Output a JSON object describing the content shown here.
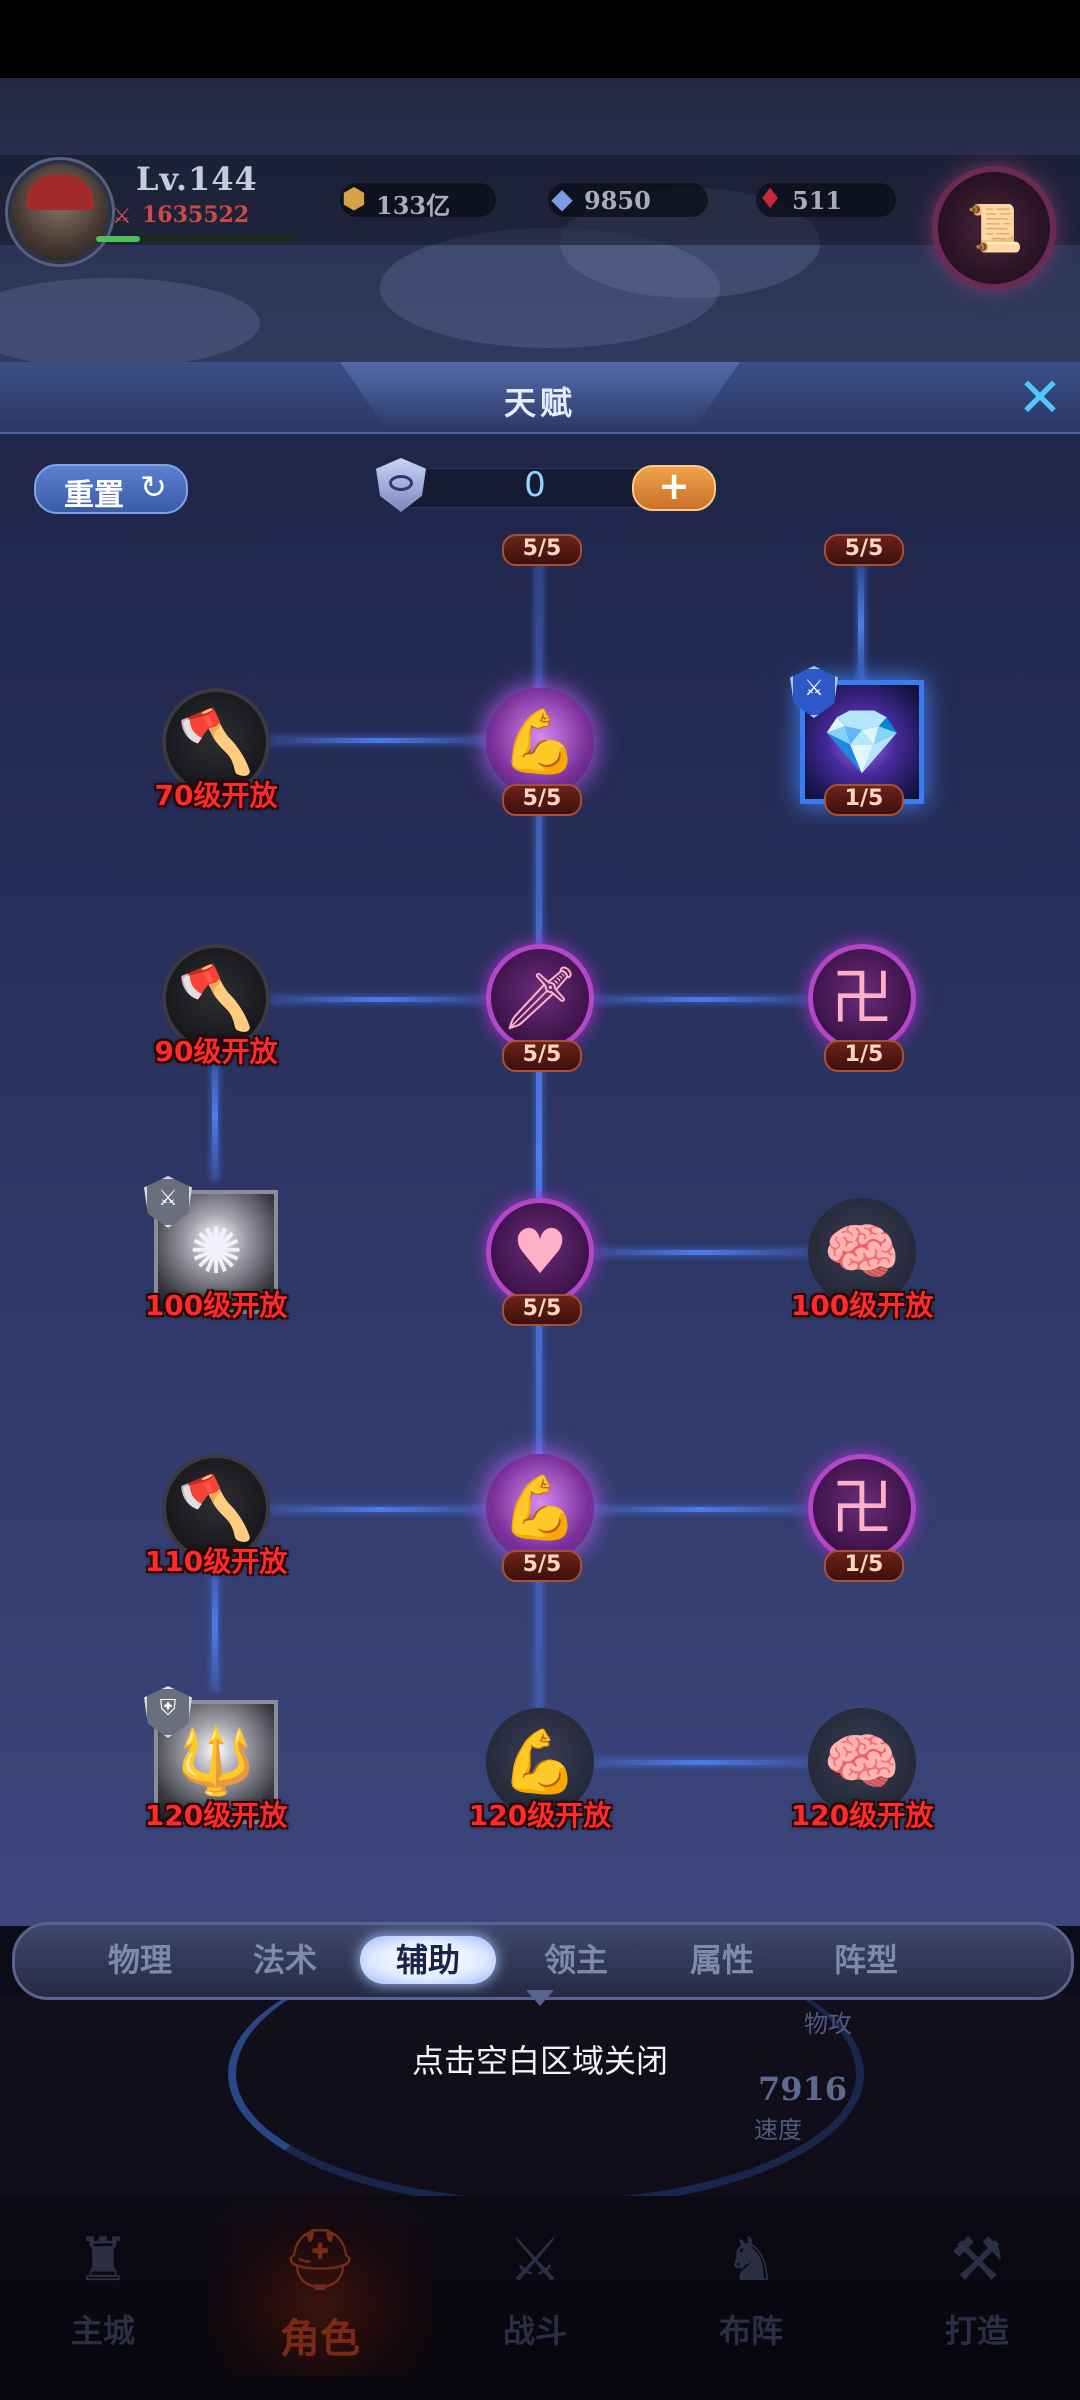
{
  "player": {
    "level": "Lv.144",
    "power": "1635522",
    "exp_fraction": 0.22
  },
  "resources": [
    {
      "icon": "gold-coin-icon",
      "value": "133亿"
    },
    {
      "icon": "diamond-icon",
      "value": "9850"
    },
    {
      "icon": "ruby-icon",
      "value": "511"
    }
  ],
  "panel": {
    "title": "天赋",
    "reset_label": "重置",
    "points": "0",
    "add_symbol": "+"
  },
  "talents": {
    "top_counts": [
      "5/5",
      "5/5"
    ],
    "r1": {
      "left": "70级开放",
      "center": "5/5",
      "right": "1/5"
    },
    "r2": {
      "left": "90级开放",
      "center": "5/5",
      "right": "1/5"
    },
    "r3": {
      "left": "100级开放",
      "center": "5/5",
      "right": "100级开放"
    },
    "r4": {
      "left": "110级开放",
      "center": "5/5",
      "right": "1/5"
    },
    "r5": {
      "left": "120级开放",
      "center": "120级开放",
      "right": "120级开放"
    }
  },
  "tabs": [
    "物理",
    "法术",
    "辅助",
    "领主",
    "属性",
    "阵型"
  ],
  "active_tab": "辅助",
  "close_hint": "点击空白区域关闭",
  "background_stats": [
    {
      "value": "7916",
      "label": "速度"
    },
    {
      "label": "物攻"
    }
  ],
  "nav": [
    "主城",
    "角色",
    "战斗",
    "布阵",
    "打造"
  ],
  "active_nav": "角色",
  "colors": {
    "locked_text": "#ff2a2a",
    "tree_line": "#4d7be8",
    "purple_node": "#b447c7"
  }
}
